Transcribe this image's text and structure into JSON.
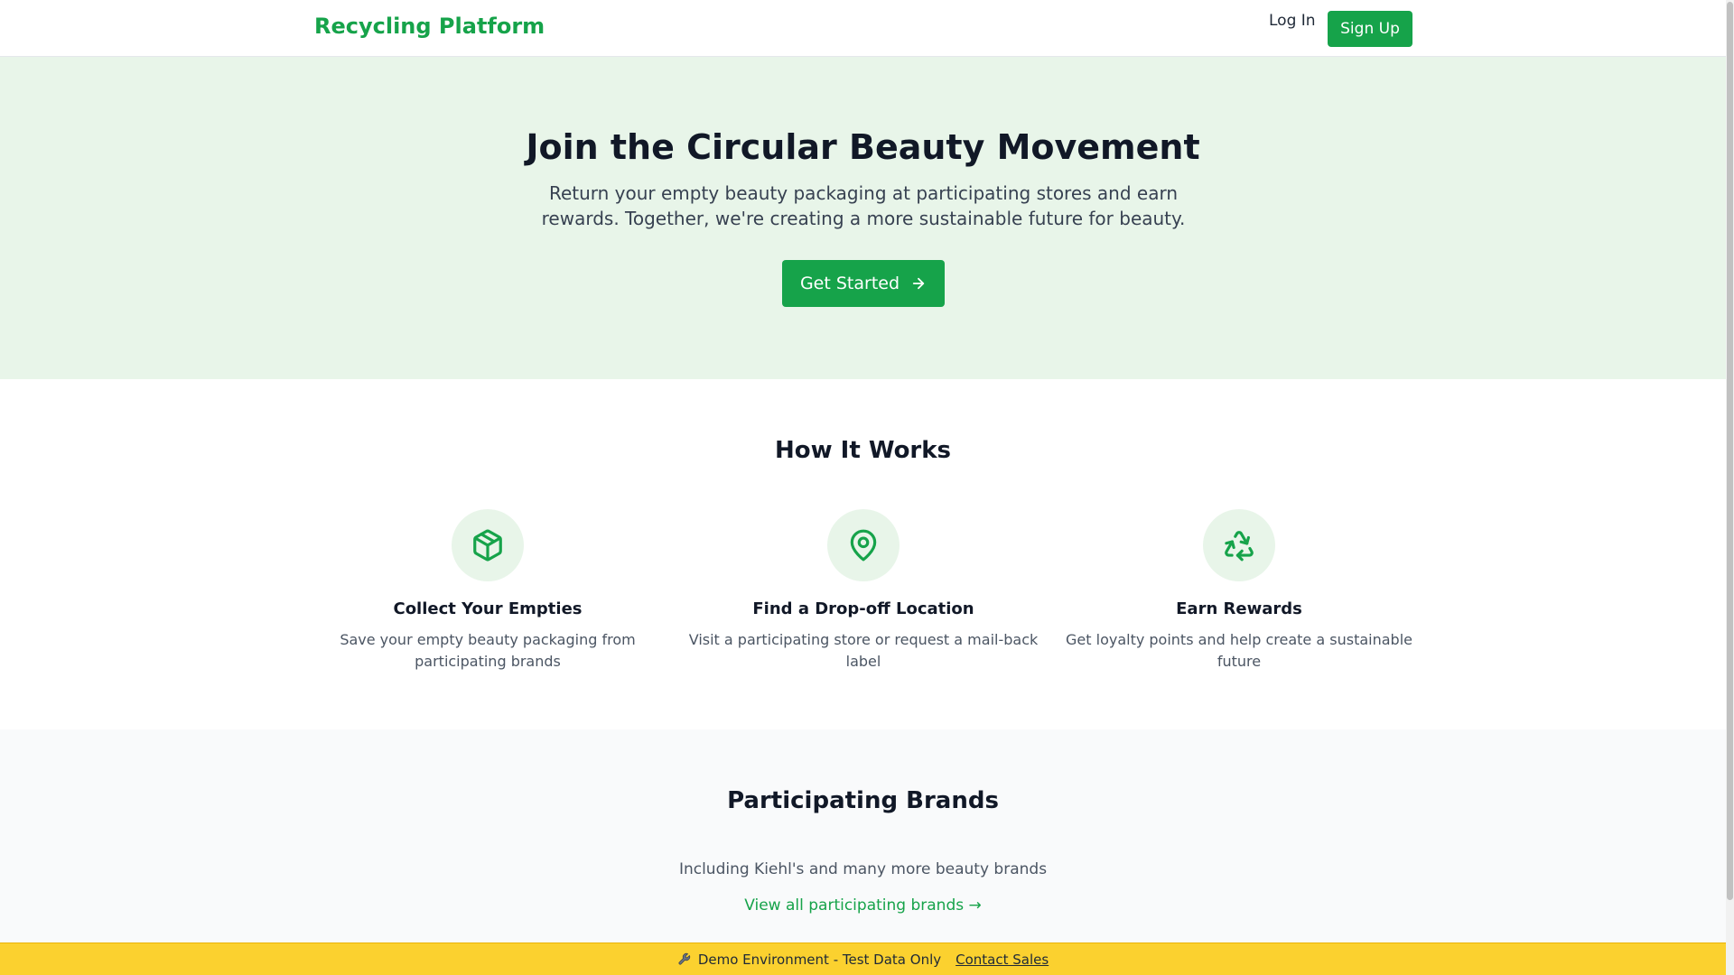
{
  "header": {
    "brand": "Recycling Platform",
    "login_label": "Log In",
    "signup_label": "Sign Up"
  },
  "hero": {
    "title": "Join the Circular Beauty Movement",
    "description": "Return your empty beauty packaging at participating stores and earn rewards. Together, we're creating a more sustainable future for beauty.",
    "cta_label": "Get Started",
    "cta_icon": "arrow-right-icon"
  },
  "how_it_works": {
    "title": "How It Works",
    "steps": [
      {
        "icon": "package-icon",
        "title": "Collect Your Empties",
        "description": "Save your empty beauty packaging from participating brands"
      },
      {
        "icon": "map-pin-icon",
        "title": "Find a Drop-off Location",
        "description": "Visit a participating store or request a mail-back label"
      },
      {
        "icon": "recycle-icon",
        "title": "Earn Rewards",
        "description": "Get loyalty points and help create a sustainable future"
      }
    ]
  },
  "brands": {
    "title": "Participating Brands",
    "text": "Including Kiehl's and many more beauty brands",
    "link_label": "View all participating brands →"
  },
  "demo_banner": {
    "icon": "wrench-icon",
    "text": "Demo Environment - Test Data Only",
    "link_label": "Contact Sales"
  },
  "colors": {
    "brand_green": "#16a34a",
    "hero_bg": "#e8f5e9",
    "banner_yellow": "#fbd12f"
  }
}
